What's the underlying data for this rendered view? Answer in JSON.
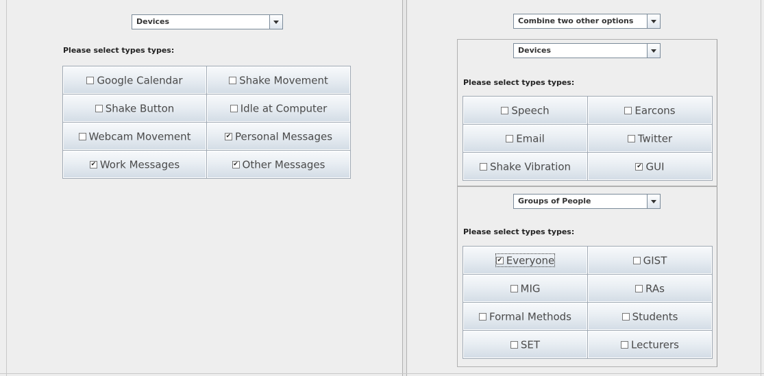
{
  "left": {
    "combo_value": "Devices",
    "prompt": "Please select types types:",
    "options": [
      {
        "label": "Google Calendar",
        "checked": false
      },
      {
        "label": "Shake Movement",
        "checked": false
      },
      {
        "label": "Shake Button",
        "checked": false
      },
      {
        "label": "Idle at Computer",
        "checked": false
      },
      {
        "label": "Webcam Movement",
        "checked": false
      },
      {
        "label": "Personal Messages",
        "checked": true
      },
      {
        "label": "Work Messages",
        "checked": true
      },
      {
        "label": "Other Messages",
        "checked": true
      }
    ]
  },
  "right": {
    "combo_value": "Combine two other options",
    "top": {
      "combo_value": "Devices",
      "prompt": "Please select types types:",
      "options": [
        {
          "label": "Speech",
          "checked": false
        },
        {
          "label": "Earcons",
          "checked": false
        },
        {
          "label": "Email",
          "checked": false
        },
        {
          "label": "Twitter",
          "checked": false
        },
        {
          "label": "Shake Vibration",
          "checked": false
        },
        {
          "label": "GUI",
          "checked": true
        }
      ]
    },
    "bottom": {
      "combo_value": "Groups of People",
      "prompt": "Please select types types:",
      "options": [
        {
          "label": "Everyone",
          "checked": true,
          "focused": true
        },
        {
          "label": "GIST",
          "checked": false
        },
        {
          "label": "MIG",
          "checked": false
        },
        {
          "label": "RAs",
          "checked": false
        },
        {
          "label": "Formal Methods",
          "checked": false
        },
        {
          "label": "Students",
          "checked": false
        },
        {
          "label": "SET",
          "checked": false
        },
        {
          "label": "Lecturers",
          "checked": false
        }
      ]
    }
  },
  "icons": {
    "combo_arrow": "chevron-down-icon",
    "check": "check-icon"
  },
  "checkmark_glyph": "✔"
}
